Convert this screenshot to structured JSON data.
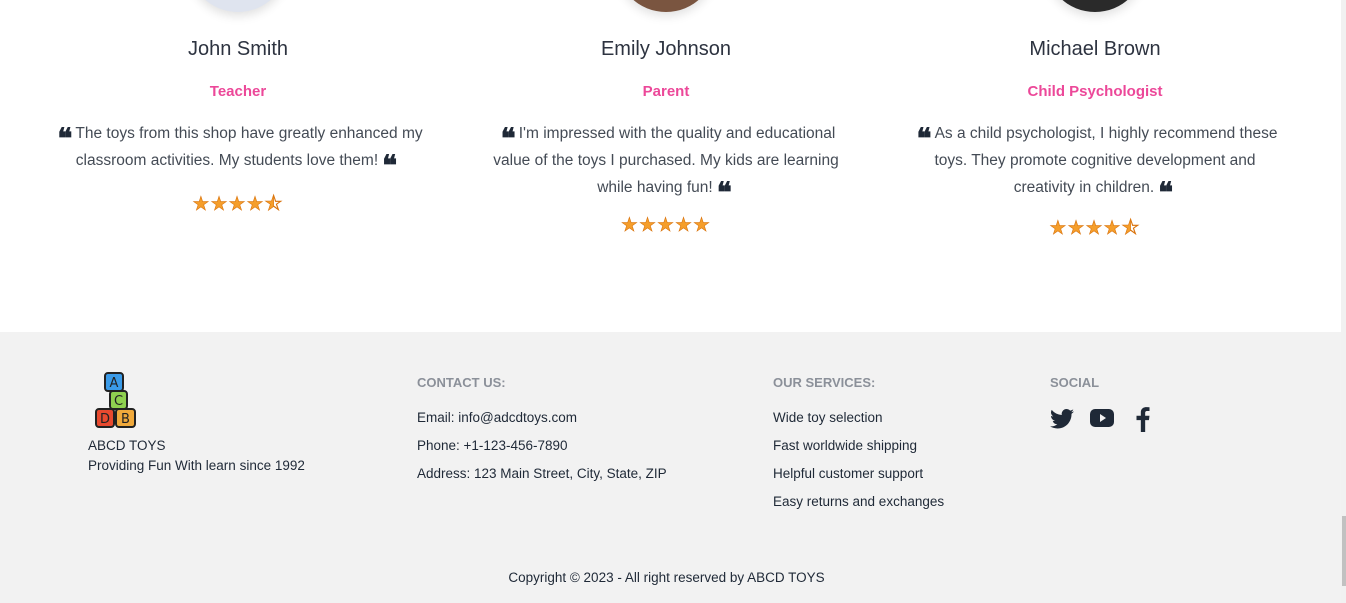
{
  "testimonials": [
    {
      "name": "John Smith",
      "role": "Teacher",
      "quote": "The toys from this shop have greatly enhanced my classroom activities. My students love them!",
      "rating": 4.5,
      "rating_text": "★★★★⯪"
    },
    {
      "name": "Emily Johnson",
      "role": "Parent",
      "quote": "I'm impressed with the quality and educational value of the toys I purchased. My kids are learning while having fun!",
      "rating": 5,
      "rating_text": "★★★★★"
    },
    {
      "name": "Michael Brown",
      "role": "Child Psychologist",
      "quote": "As a child psychologist, I highly recommend these toys. They promote cognitive development and creativity in children.",
      "rating": 4.5,
      "rating_text": "★★★★⯪"
    }
  ],
  "footer": {
    "brand": {
      "name": "ABCD TOYS",
      "tagline": "Providing Fun With learn since 1992",
      "logo_letters": [
        "A",
        "C",
        "D",
        "B"
      ]
    },
    "contact": {
      "heading": "CONTACT US:",
      "items": [
        "Email: info@adcdtoys.com",
        "Phone: +1-123-456-7890",
        "Address: 123 Main Street, City, State, ZIP"
      ]
    },
    "services": {
      "heading": "OUR SERVICES:",
      "items": [
        "Wide toy selection",
        "Fast worldwide shipping",
        "Helpful customer support",
        "Easy returns and exchanges"
      ]
    },
    "social": {
      "heading": "SOCIAL",
      "icons": [
        "twitter-icon",
        "youtube-icon",
        "facebook-icon"
      ]
    },
    "copyright": "Copyright © 2023 - All right reserved by ABCD TOYS"
  },
  "colors": {
    "accent": "#ec4899",
    "star": "#f59e2b",
    "footer_bg": "#f2f2f2",
    "text": "#1f2937"
  }
}
